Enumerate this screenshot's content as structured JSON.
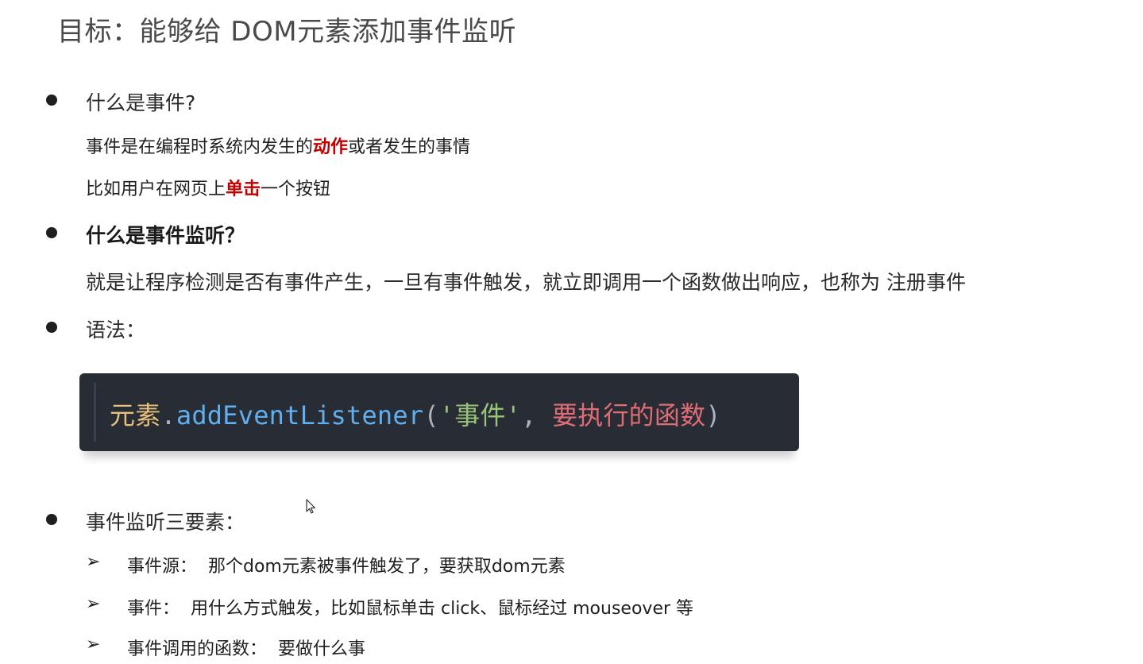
{
  "title": "目标：能够给 DOM元素添加事件监听",
  "sections": {
    "what_is_event": {
      "question": "什么是事件?",
      "line1_pre": "事件是在编程时系统内发生的",
      "line1_hl": "动作",
      "line1_post": "或者发生的事情",
      "line2_pre": "比如用户在网页上",
      "line2_hl": "单击",
      "line2_post": "一个按钮"
    },
    "what_is_listener": {
      "question": "什么是事件监听？",
      "answer": "就是让程序检测是否有事件产生，一旦有事件触发，就立即调用一个函数做出响应，也称为 注册事件"
    },
    "syntax": {
      "label": "语法：",
      "code": {
        "element": "元素",
        "dot": ".",
        "method": "addEventListener",
        "open": "(",
        "event_str": "'事件'",
        "comma": ", ",
        "handler": "要执行的函数",
        "close": ")"
      }
    },
    "three_elements": {
      "label": "事件监听三要素：",
      "items": [
        {
          "arrow": "➢",
          "text": "事件源：  那个dom元素被事件触发了，要获取dom元素"
        },
        {
          "arrow": "➢",
          "text": "事件：  用什么方式触发，比如鼠标单击 click、鼠标经过 mouseover 等"
        },
        {
          "arrow": "➢",
          "text": "事件调用的函数：  要做什么事"
        }
      ]
    }
  },
  "colors": {
    "highlight": "#c00000",
    "code_bg": "#282c34",
    "code_element": "#e5c07b",
    "code_method": "#61afef",
    "code_string": "#98c379",
    "code_handler": "#e06c75"
  },
  "icons": {
    "bullet": "filled-circle",
    "sub_bullet": "arrow-right",
    "cursor": "mouse-pointer-icon"
  }
}
